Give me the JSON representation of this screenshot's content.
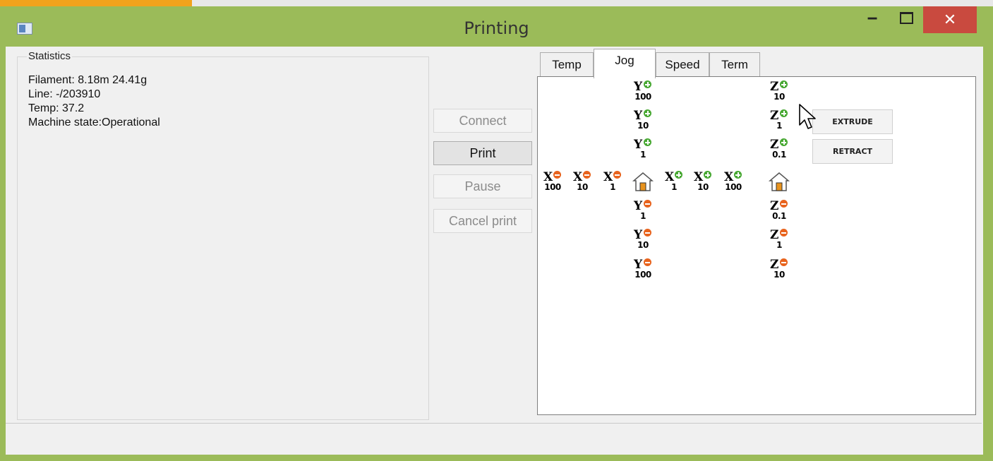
{
  "window": {
    "title": "Printing",
    "minimize_glyph": "‒",
    "close_glyph": "✕"
  },
  "statistics": {
    "legend": "Statistics",
    "lines": [
      "Filament: 8.18m 24.41g",
      "Line: -/203910",
      "Temp: 37.2",
      "Machine state:Operational"
    ]
  },
  "controls": {
    "connect": "Connect",
    "print": "Print",
    "pause": "Pause",
    "cancel": "Cancel print"
  },
  "tabs": [
    {
      "label": "Temp"
    },
    {
      "label": "Jog",
      "selected": true
    },
    {
      "label": "Speed"
    },
    {
      "label": "Term"
    }
  ],
  "jog": {
    "y_plus": [
      {
        "axis": "Y",
        "step": "100",
        "sign": "plus"
      },
      {
        "axis": "Y",
        "step": "10",
        "sign": "plus"
      },
      {
        "axis": "Y",
        "step": "1",
        "sign": "plus"
      }
    ],
    "x_minus": [
      {
        "axis": "X",
        "step": "100",
        "sign": "minus"
      },
      {
        "axis": "X",
        "step": "10",
        "sign": "minus"
      },
      {
        "axis": "X",
        "step": "1",
        "sign": "minus"
      }
    ],
    "x_plus": [
      {
        "axis": "X",
        "step": "1",
        "sign": "plus"
      },
      {
        "axis": "X",
        "step": "10",
        "sign": "plus"
      },
      {
        "axis": "X",
        "step": "100",
        "sign": "plus"
      }
    ],
    "y_minus": [
      {
        "axis": "Y",
        "step": "1",
        "sign": "minus"
      },
      {
        "axis": "Y",
        "step": "10",
        "sign": "minus"
      },
      {
        "axis": "Y",
        "step": "100",
        "sign": "minus"
      }
    ],
    "z_plus": [
      {
        "axis": "Z",
        "step": "10",
        "sign": "plus"
      },
      {
        "axis": "Z",
        "step": "1",
        "sign": "plus"
      },
      {
        "axis": "Z",
        "step": "0.1",
        "sign": "plus"
      }
    ],
    "z_minus": [
      {
        "axis": "Z",
        "step": "0.1",
        "sign": "minus"
      },
      {
        "axis": "Z",
        "step": "1",
        "sign": "minus"
      },
      {
        "axis": "Z",
        "step": "10",
        "sign": "minus"
      }
    ],
    "extrude": "EXTRUDE",
    "retract": "RETRACT"
  },
  "colors": {
    "titlebar": "#9bbb59",
    "close_button": "#c94a3f",
    "plus_dot": "#47a832",
    "minus_dot": "#e8631d"
  }
}
